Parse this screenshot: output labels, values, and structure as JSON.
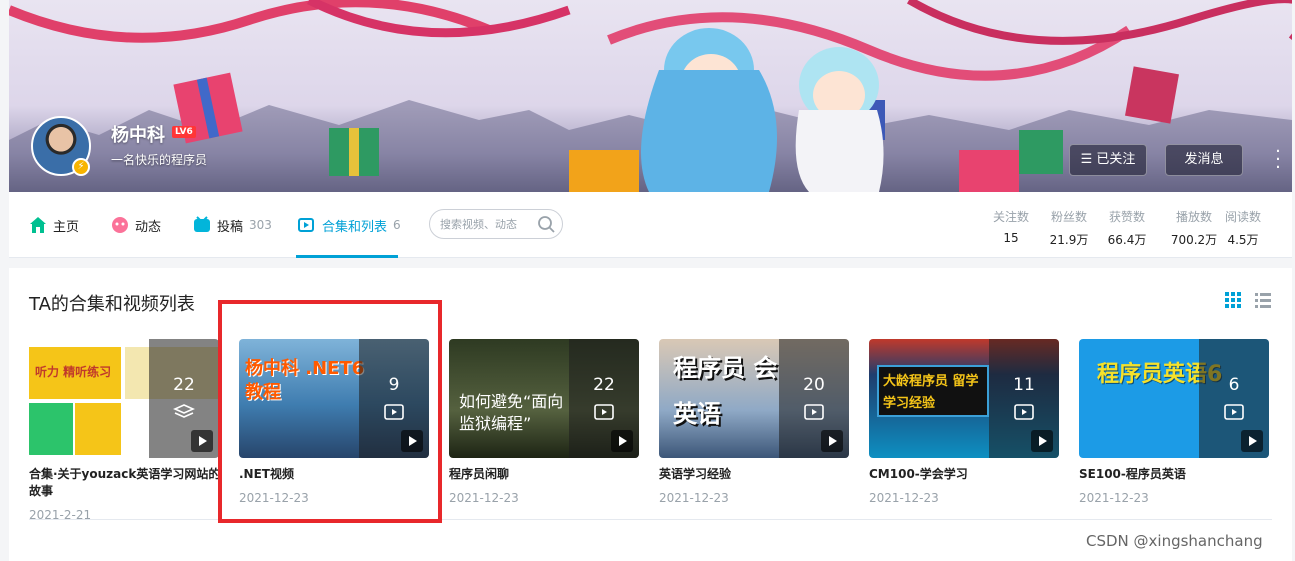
{
  "profile": {
    "name": "杨中科",
    "level": "LV6",
    "sign": "一名快乐的程序员",
    "followed_label": "已关注",
    "message_label": "发消息"
  },
  "nav": {
    "home": "主页",
    "dynamic": "动态",
    "uploads": "投稿",
    "uploads_count": "303",
    "collections": "合集和列表",
    "collections_count": "6",
    "search_placeholder": "搜索视频、动态"
  },
  "stats": [
    {
      "label": "关注数",
      "value": "15"
    },
    {
      "label": "粉丝数",
      "value": "21.9万"
    },
    {
      "label": "获赞数",
      "value": "66.4万"
    },
    {
      "label": "播放数",
      "value": "700.2万"
    },
    {
      "label": "阅读数",
      "value": "4.5万"
    }
  ],
  "section": {
    "title": "TA的合集和视频列表"
  },
  "cards": [
    {
      "count": "22",
      "title": "合集·关于youzack英语学习网站的故事",
      "date": "2021-2-21",
      "thumb_text": "听力 精听练习",
      "bg": "#f5c518"
    },
    {
      "count": "9",
      "title": ".NET视频",
      "date": "2021-12-23",
      "thumb_text": "杨中科 .NET6教程",
      "bg": "#3f7db0"
    },
    {
      "count": "22",
      "title": "程序员闲聊",
      "date": "2021-12-23",
      "thumb_text": "如何避免“面向监狱编程”",
      "bg": "#3b4a2e"
    },
    {
      "count": "20",
      "title": "英语学习经验",
      "date": "2021-12-23",
      "thumb_text": "程序员 会英语",
      "bg": "#5a7ea8"
    },
    {
      "count": "11",
      "title": "CM100-学会学习",
      "date": "2021-12-23",
      "thumb_text": "大龄程序员 留学学习经验",
      "bg": "#1f3d6e"
    },
    {
      "count": "6",
      "title": "SE100-程序员英语",
      "date": "2021-12-23",
      "thumb_text": "程序员英语6",
      "bg": "#1c9be6"
    }
  ],
  "watermark": "CSDN @xingshanchang",
  "colors": {
    "accent": "#00a1d6",
    "highlight": "#e8282b"
  }
}
